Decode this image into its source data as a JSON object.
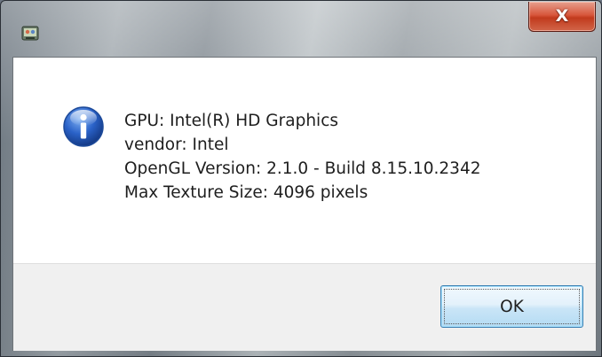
{
  "window": {
    "title": "",
    "close_glyph": "X"
  },
  "icons": {
    "app": "application-icon",
    "message": "information-icon",
    "close": "close-icon"
  },
  "message": {
    "lines": [
      "GPU: Intel(R) HD Graphics",
      "vendor: Intel",
      "OpenGL Version: 2.1.0 - Build 8.15.10.2342",
      "Max Texture Size: 4096 pixels"
    ]
  },
  "buttons": {
    "ok_label": "OK"
  },
  "colors": {
    "info_blue": "#2a62c8",
    "close_red": "#c8452a",
    "button_border": "#3c7fb1"
  }
}
